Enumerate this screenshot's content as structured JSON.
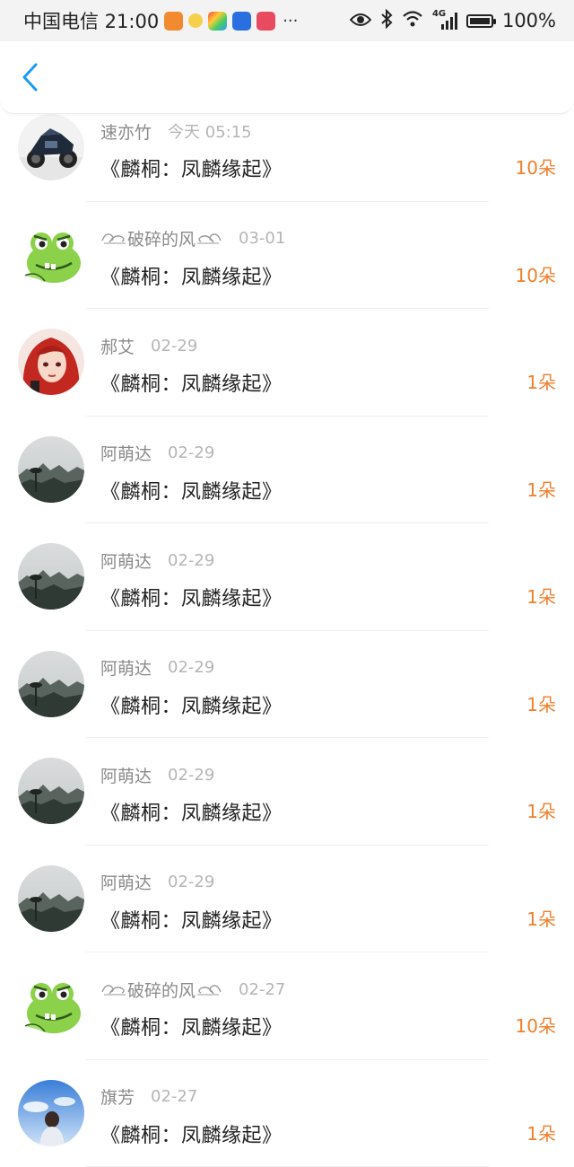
{
  "status_bar": {
    "carrier_time": "中国电信 21:00",
    "network": "4G",
    "battery": "100%",
    "more": "···"
  },
  "nav": {
    "back_icon": "chevron-left-icon",
    "accent_color": "#1a9bf0"
  },
  "list": [
    {
      "user": "速亦竹",
      "time": "今天 05:15",
      "title": "《麟桐：凤麟缘起》",
      "count": "10朵",
      "avatar": "motorcycle"
    },
    {
      "user": "破碎的风",
      "decorated": true,
      "time": "03-01",
      "title": "《麟桐：凤麟缘起》",
      "count": "10朵",
      "avatar": "frog"
    },
    {
      "user": "郝艾",
      "time": "02-29",
      "title": "《麟桐：凤麟缘起》",
      "count": "1朵",
      "avatar": "redhair"
    },
    {
      "user": "阿萌达",
      "time": "02-29",
      "title": "《麟桐：凤麟缘起》",
      "count": "1朵",
      "avatar": "landscape"
    },
    {
      "user": "阿萌达",
      "time": "02-29",
      "title": "《麟桐：凤麟缘起》",
      "count": "1朵",
      "avatar": "landscape"
    },
    {
      "user": "阿萌达",
      "time": "02-29",
      "title": "《麟桐：凤麟缘起》",
      "count": "1朵",
      "avatar": "landscape"
    },
    {
      "user": "阿萌达",
      "time": "02-29",
      "title": "《麟桐：凤麟缘起》",
      "count": "1朵",
      "avatar": "landscape"
    },
    {
      "user": "阿萌达",
      "time": "02-29",
      "title": "《麟桐：凤麟缘起》",
      "count": "1朵",
      "avatar": "landscape"
    },
    {
      "user": "破碎的风",
      "decorated": true,
      "time": "02-27",
      "title": "《麟桐：凤麟缘起》",
      "count": "10朵",
      "avatar": "frog"
    },
    {
      "user": "旗芳",
      "time": "02-27",
      "title": "《麟桐：凤麟缘起》",
      "count": "1朵",
      "avatar": "sky"
    }
  ],
  "colors": {
    "count": "#f07f2d",
    "username": "#8a8a8a",
    "time": "#b5b5b5",
    "title": "#222222"
  }
}
